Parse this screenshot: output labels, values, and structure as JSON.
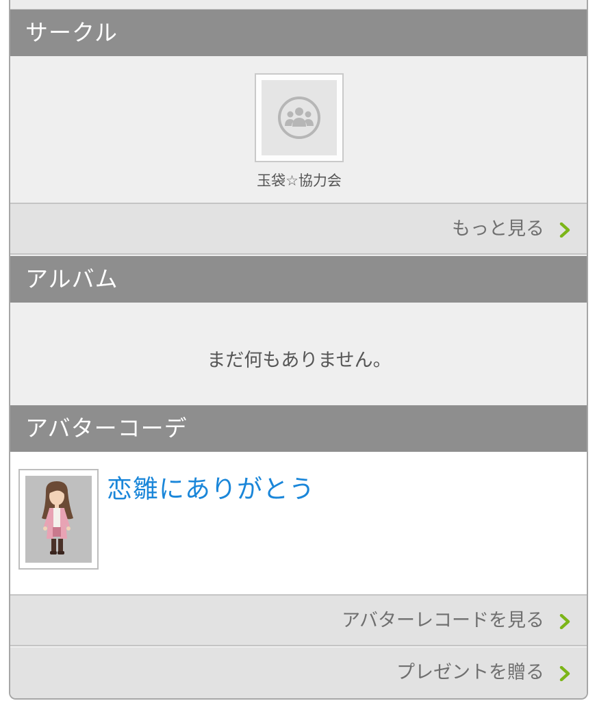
{
  "circle": {
    "header": "サークル",
    "item_name": "玉袋☆協力会",
    "more_label": "もっと見る"
  },
  "album": {
    "header": "アルバム",
    "empty_message": "まだ何もありません。"
  },
  "avatar_coord": {
    "header": "アバターコーデ",
    "title": "恋雛にありがとう",
    "record_label": "アバターレコードを見る",
    "present_label": "プレゼントを贈る"
  },
  "colors": {
    "header_bg": "#8e8e8e",
    "link_blue": "#1a86d9",
    "chevron_green": "#7cb518"
  }
}
